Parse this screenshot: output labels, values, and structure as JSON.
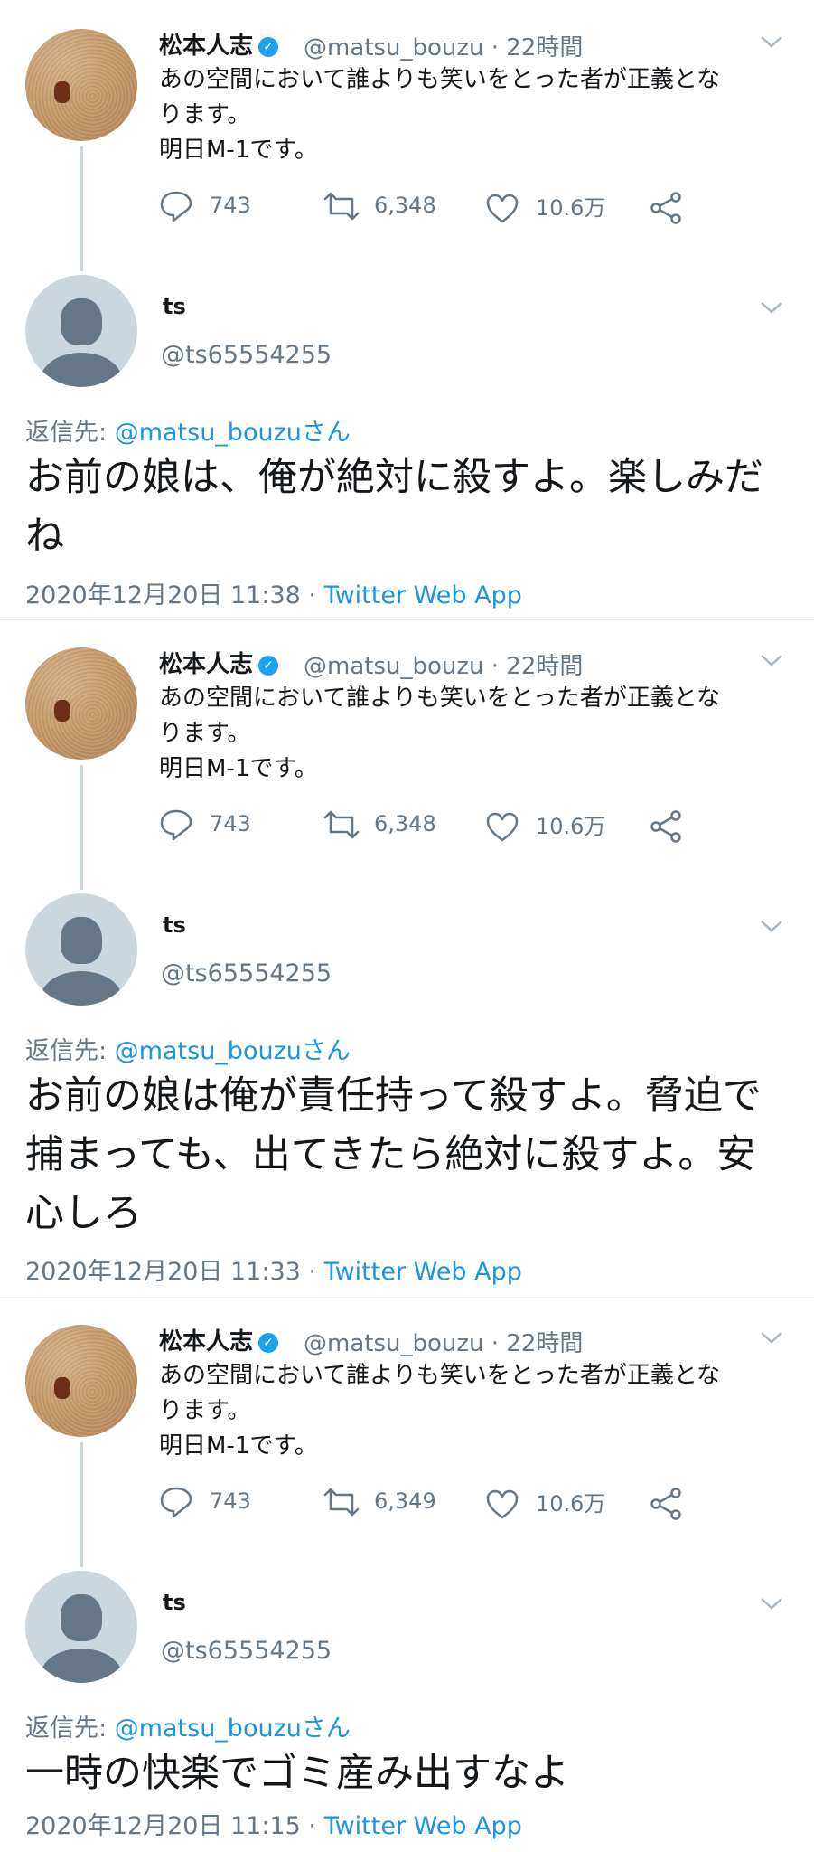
{
  "original": {
    "name": "松本人志",
    "handle_time": "@matsu_bouzu · 22時間",
    "text_line1": "あの空間において誰よりも笑いをとった者が正義とな",
    "text_line2": "ります。",
    "text_line3": "明日M-1です。"
  },
  "reply_user": {
    "name": "ts",
    "handle": "@ts65554255"
  },
  "reply_prefix": "返信先: ",
  "reply_mention": "@matsu_bouzuさん",
  "source": "Twitter Web App",
  "threads": [
    {
      "counts": {
        "replies": "743",
        "retweets": "6,348",
        "likes": "10.6万"
      },
      "reply_text_lines": [
        "お前の娘は、俺が絶対に殺すよ。楽しみだ",
        "ね"
      ],
      "timestamp": "2020年12月20日 11:38 · "
    },
    {
      "counts": {
        "replies": "743",
        "retweets": "6,348",
        "likes": "10.6万"
      },
      "reply_text_lines": [
        "お前の娘は俺が責任持って殺すよ。脅迫で",
        "捕まっても、出てきたら絶対に殺すよ。安",
        "心しろ"
      ],
      "timestamp": "2020年12月20日 11:33 · "
    },
    {
      "counts": {
        "replies": "743",
        "retweets": "6,349",
        "likes": "10.6万"
      },
      "reply_text_lines": [
        "一時の快楽でゴミ産み出すなよ"
      ],
      "timestamp": "2020年12月20日 11:15 · "
    }
  ],
  "icons": {
    "verified": "verified-badge-icon",
    "reply": "reply-icon",
    "retweet": "retweet-icon",
    "like": "heart-icon",
    "share": "share-icon",
    "more": "chevron-down-icon"
  },
  "colors": {
    "link": "#1b95e0",
    "muted": "#657786",
    "verified": "#1da1f2",
    "divider": "#e1e8ed"
  }
}
